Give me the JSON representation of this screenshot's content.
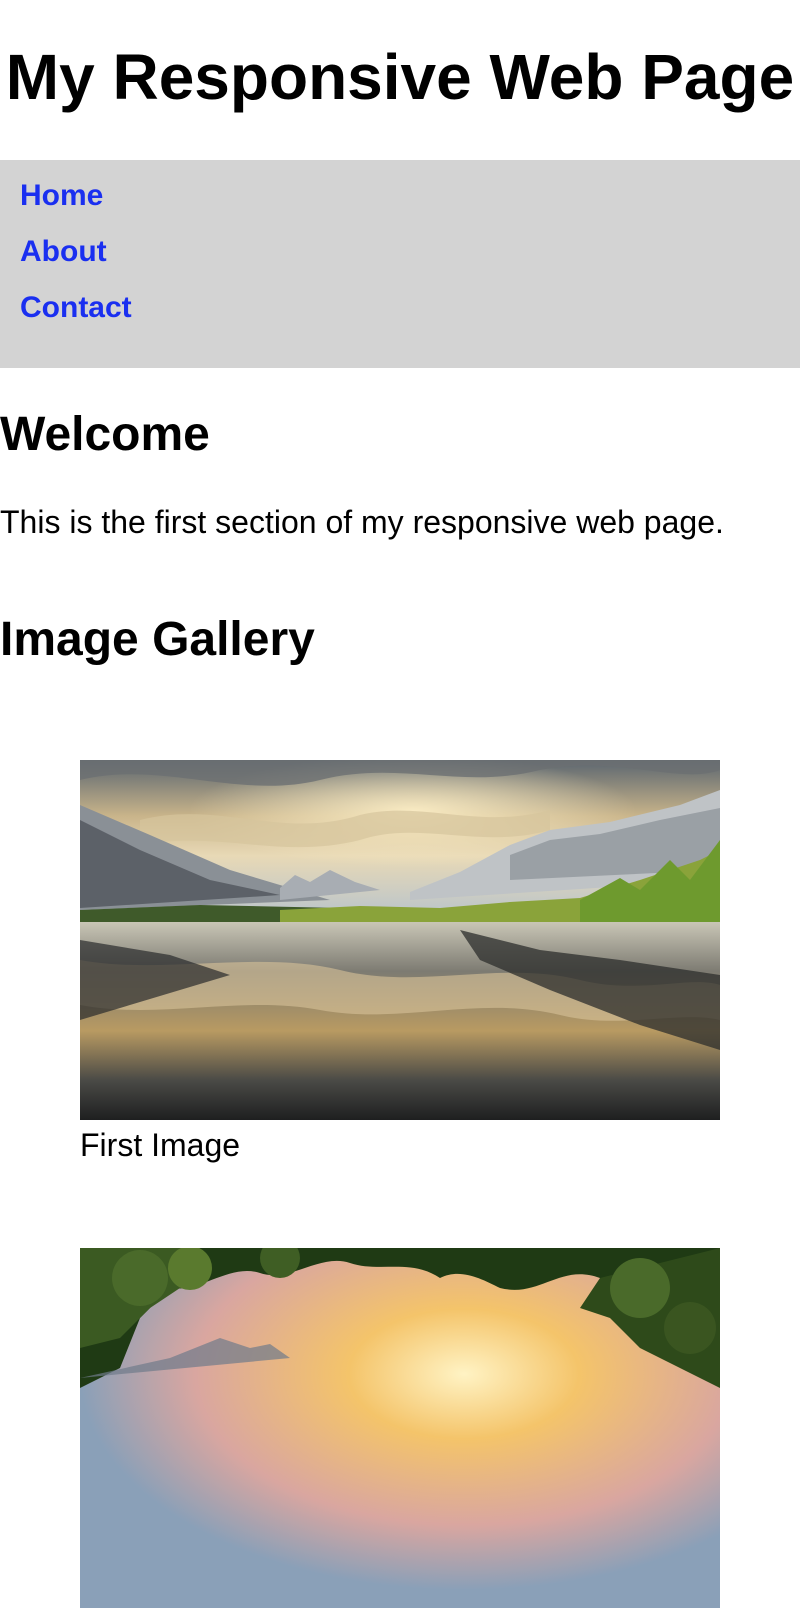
{
  "header": {
    "title": "My Responsive Web Page"
  },
  "nav": {
    "items": [
      {
        "label": "Home"
      },
      {
        "label": "About"
      },
      {
        "label": "Contact"
      }
    ],
    "background": "#d3d3d3",
    "link_color": "#1a2ff0"
  },
  "welcome": {
    "heading": "Welcome",
    "text": "This is the first section of my responsive web page."
  },
  "gallery": {
    "heading": "Image Gallery",
    "images": [
      {
        "caption": "First Image",
        "subject": "mountain lake with cloud reflection at sunset"
      },
      {
        "caption": "",
        "subject": "sunset framed by tree foliage"
      }
    ]
  }
}
